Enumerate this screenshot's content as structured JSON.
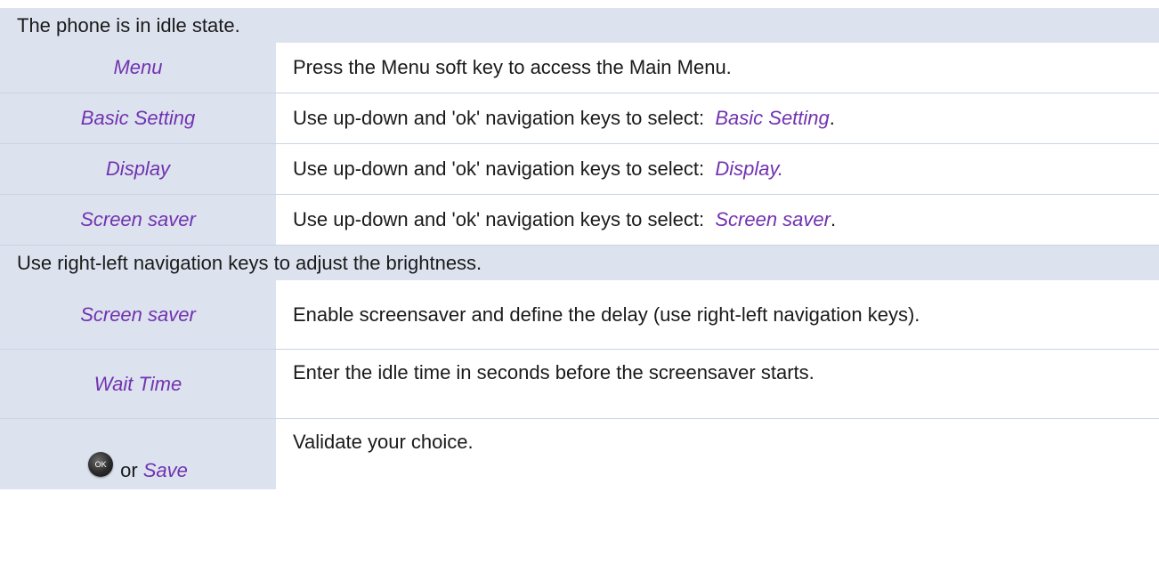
{
  "procedure": {
    "intro": "The phone is in idle state.",
    "steps_a": [
      {
        "key": "Menu",
        "desc": "Press the Menu soft key to access the Main Menu.",
        "desc_hl": "",
        "desc_after": ""
      },
      {
        "key": "Basic Setting",
        "desc": "Use up-down and 'ok' navigation keys to select: ",
        "desc_hl": "Basic Setting",
        "desc_after": "."
      },
      {
        "key": "Display",
        "desc": "Use up-down and 'ok' navigation keys to select: ",
        "desc_hl": "Display.",
        "desc_after": ""
      },
      {
        "key": "Screen saver",
        "desc": "Use up-down and 'ok' navigation keys to select: ",
        "desc_hl": "Screen saver",
        "desc_after": "."
      }
    ],
    "brightness_note": "Use right-left navigation keys to adjust the brightness.",
    "steps_b": [
      {
        "key": "Screen saver",
        "desc": "Enable screensaver and define the delay (use right-left navigation keys)."
      },
      {
        "key": "Wait Time",
        "desc": "Enter the idle time in seconds before the screensaver starts."
      }
    ],
    "final_step": {
      "icon_label": "OK",
      "or_word": "or",
      "key": "Save",
      "desc": "Validate your choice."
    }
  },
  "colors": {
    "accent": "#7232b0",
    "header_bg": "#dce3ef",
    "divider": "#c9d3e2"
  },
  "icons": {
    "ok_key": "ok-button-icon"
  }
}
